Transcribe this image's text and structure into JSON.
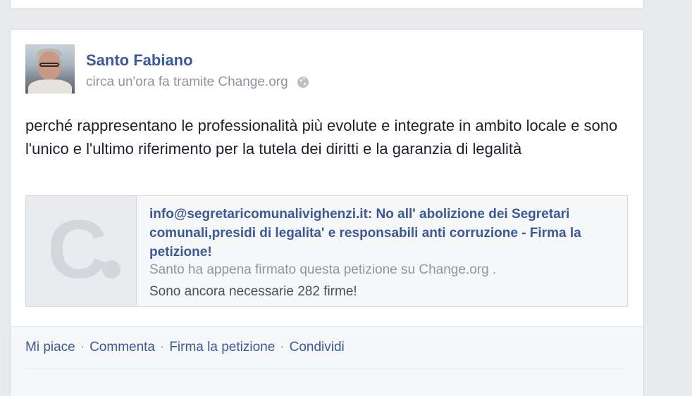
{
  "post": {
    "author": "Santo Fabiano",
    "meta": "circa un'ora fa tramite Change.org",
    "privacy_icon": "globe-icon",
    "text": "perché rappresentano le professionalità più evolute e integrate in ambito locale e sono l'unico e l'ultimo riferimento per la tutela dei diritti e la garanzia di legalità",
    "share": {
      "thumb_letter": "C",
      "title": "info@segretaricomunalivighenzi.it: No all' abolizione dei Segretari comunali,presidi di legalita' e responsabili anti corruzione - Firma la petizione!",
      "description": "Santo ha appena firmato questa petizione su Change.org .",
      "subtext": "Sono ancora necessarie 282 firme!"
    },
    "actions": {
      "like": "Mi piace",
      "comment": "Commenta",
      "sign": "Firma la petizione",
      "share": "Condividi",
      "separator": "·"
    }
  },
  "colors": {
    "link": "#3b5998",
    "muted": "#90949c",
    "text": "#1d2129",
    "background": "#e9eaed"
  }
}
